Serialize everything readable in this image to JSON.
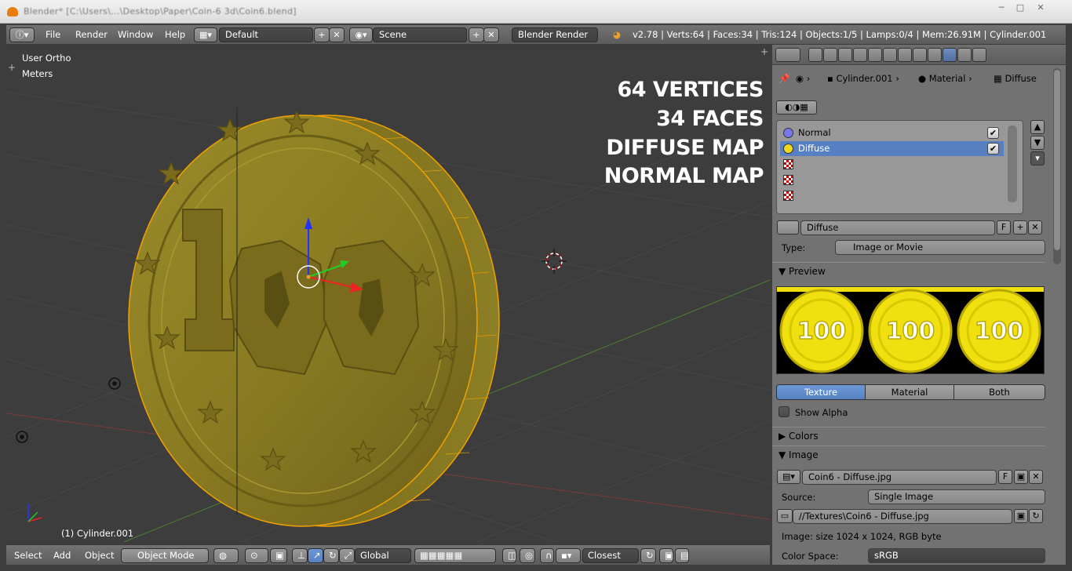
{
  "window": {
    "title": "Blender* [C:\\Users\\...\\Desktop\\Paper\\Coin-6 3d\\Coin6.blend]",
    "min": "─",
    "max": "□",
    "close": "✕"
  },
  "topbar": {
    "menus": [
      "File",
      "Render",
      "Window",
      "Help"
    ],
    "layout": "Default",
    "scene": "Scene",
    "engine": "Blender Render",
    "stats": "v2.78 | Verts:64 | Faces:34 | Tris:124 | Objects:1/5 | Lamps:0/4 | Mem:26.91M | Cylinder.001"
  },
  "viewport": {
    "view_name": "User Ortho",
    "units": "Meters",
    "object_label": "(1) Cylinder.001",
    "overlay_lines": [
      "64 VERTICES",
      "34 FACES",
      "DIFFUSE MAP",
      "NORMAL MAP"
    ],
    "coin_color": "#8a7a1c"
  },
  "bottombar": {
    "menus": [
      "Select",
      "Add",
      "Object"
    ],
    "mode": "Object Mode",
    "orientation": "Global",
    "snap": "Closest"
  },
  "properties": {
    "breadcrumb": [
      "Cylinder.001",
      "Material",
      "Diffuse"
    ],
    "slots": [
      {
        "name": "Normal",
        "selected": false,
        "checked": true
      },
      {
        "name": "Diffuse",
        "selected": true,
        "checked": true
      },
      {
        "name": "",
        "selected": false,
        "checked": false
      },
      {
        "name": "",
        "selected": false,
        "checked": false
      },
      {
        "name": "",
        "selected": false,
        "checked": false
      }
    ],
    "texture_name": "Diffuse",
    "texture_f": "F",
    "type_label": "Type:",
    "type_value": "Image or Movie",
    "preview_header": "Preview",
    "preview_tabs": [
      "Texture",
      "Material",
      "Both"
    ],
    "show_alpha": "Show Alpha",
    "colors_header": "Colors",
    "image_header": "Image",
    "image_name": "Coin6 - Diffuse.jpg",
    "image_f": "F",
    "source_label": "Source:",
    "source_value": "Single Image",
    "filepath": "//Textures\\Coin6 - Diffuse.jpg",
    "image_info": "Image: size 1024 x 1024, RGB byte",
    "colorspace_label": "Color Space:",
    "colorspace_value": "sRGB",
    "preview_coin_text": "100",
    "accent": "#5680c2"
  }
}
